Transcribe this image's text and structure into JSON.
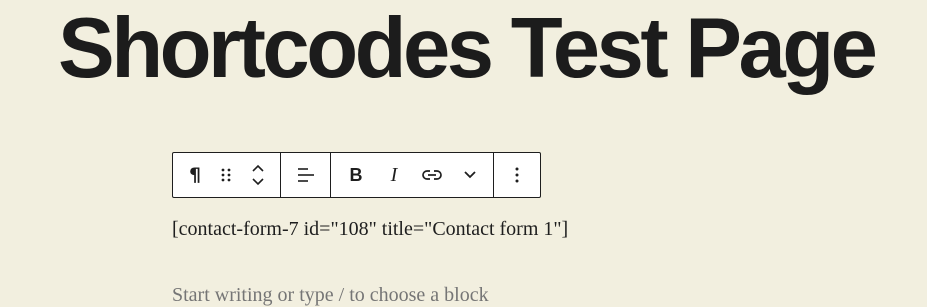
{
  "page": {
    "title": "Shortcodes Test Page"
  },
  "block_toolbar": {
    "icons": [
      "paragraph-icon",
      "drag-handle-icon",
      "move-up-icon",
      "move-down-icon",
      "align-icon",
      "bold-icon",
      "italic-icon",
      "link-icon",
      "chevron-down-icon",
      "more-options-icon"
    ],
    "paragraph_glyph": "¶",
    "bold_glyph": "B",
    "italic_glyph": "I",
    "more_glyph": "⋮"
  },
  "content": {
    "shortcode_text": "[contact-form-7 id=\"108\" title=\"Contact form 1\"]",
    "placeholder": "Start writing or type / to choose a block"
  },
  "colors": {
    "background": "#f2efdf",
    "text": "#1e1e1e",
    "placeholder": "#757575",
    "toolbar_bg": "#ffffff"
  }
}
